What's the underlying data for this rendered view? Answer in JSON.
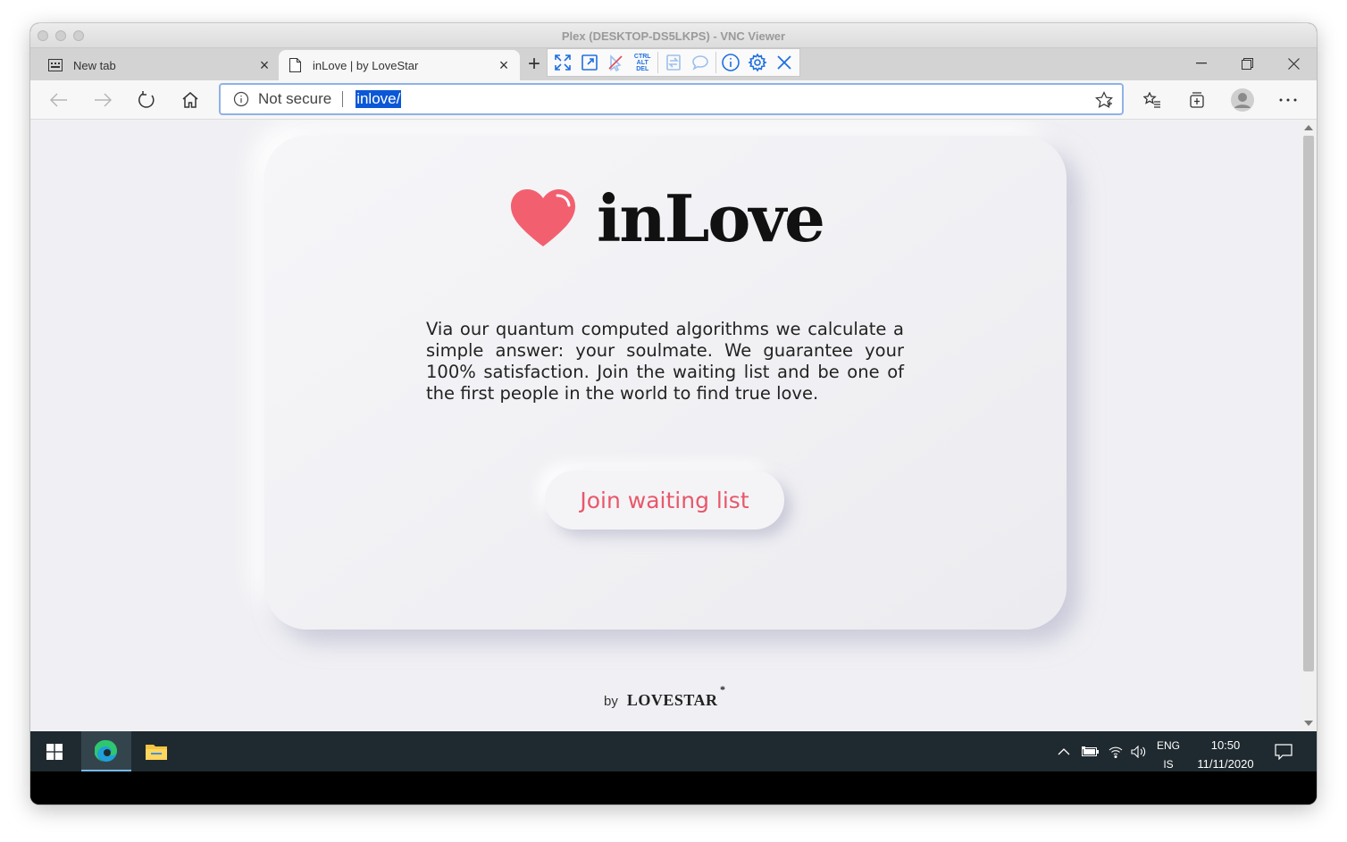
{
  "window": {
    "title": "Plex (DESKTOP-DS5LKPS) - VNC Viewer"
  },
  "tabs": [
    {
      "label": "New tab",
      "icon": "new-tab-page-icon",
      "active": false
    },
    {
      "label": "inLove | by LoveStar",
      "icon": "page-icon",
      "active": true
    }
  ],
  "address": {
    "security": "Not secure",
    "url": "inlove/"
  },
  "vnc_toolbar": {
    "ctrl_alt_del": [
      "CTRL",
      "ALT",
      "DEL"
    ]
  },
  "page": {
    "brand": "inLove",
    "description": "Via our quantum computed algorithms we calculate a simple answer: your soulmate. We guarantee your 100% satisfaction. Join the waiting list and be one of the first people in the world to find true love.",
    "cta": "Join waiting list",
    "footer_by": "by",
    "footer_brand": "LOVESTAR",
    "footer_star": "*"
  },
  "taskbar": {
    "lang_top": "ENG",
    "lang_bottom": "IS",
    "time": "10:50",
    "date": "11/11/2020"
  },
  "colors": {
    "accent": "#e8586a",
    "heart": "#f2606f",
    "url_highlight": "#0a58d6",
    "taskbar": "#1f2a30"
  }
}
